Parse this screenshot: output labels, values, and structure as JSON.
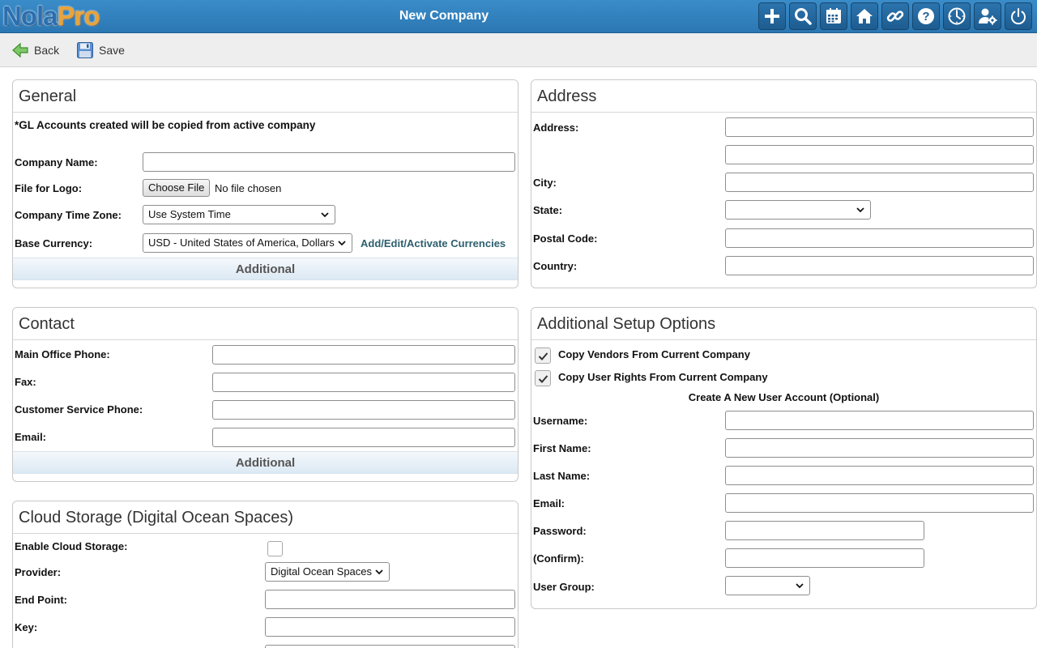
{
  "app": {
    "logo_part1": "Nola",
    "logo_part2": "Pro",
    "page_title": "New Company"
  },
  "header_icons": [
    "add-icon",
    "search-icon",
    "calendar-icon",
    "home-icon",
    "link-icon",
    "help-icon",
    "clock-icon",
    "user-settings-icon",
    "power-icon"
  ],
  "toolbar": {
    "back_label": "Back",
    "save_label": "Save"
  },
  "general": {
    "title": "General",
    "note": "*GL Accounts created will be copied from active company",
    "company_name_label": "Company Name:",
    "company_name_value": "",
    "logo_label": "File for Logo:",
    "choose_file_label": "Choose File",
    "no_file_text": "No file chosen",
    "timezone_label": "Company Time Zone:",
    "timezone_value": "Use System Time",
    "currency_label": "Base Currency:",
    "currency_value": "USD - United States of America, Dollars",
    "currency_link": "Add/Edit/Activate Currencies",
    "additional_label": "Additional"
  },
  "address": {
    "title": "Address",
    "address_label": "Address:",
    "city_label": "City:",
    "state_label": "State:",
    "postal_label": "Postal Code:",
    "country_label": "Country:"
  },
  "contact": {
    "title": "Contact",
    "phone_label": "Main Office Phone:",
    "fax_label": "Fax:",
    "cs_phone_label": "Customer Service Phone:",
    "email_label": "Email:",
    "additional_label": "Additional"
  },
  "setup": {
    "title": "Additional Setup Options",
    "copy_vendors_label": "Copy Vendors From Current Company",
    "copy_vendors_checked": true,
    "copy_rights_label": "Copy User Rights From Current Company",
    "copy_rights_checked": true,
    "new_user_heading": "Create A New User Account (Optional)",
    "username_label": "Username:",
    "first_name_label": "First Name:",
    "last_name_label": "Last Name:",
    "email_label": "Email:",
    "password_label": "Password:",
    "confirm_label": "(Confirm):",
    "user_group_label": "User Group:"
  },
  "cloud": {
    "title": "Cloud Storage (Digital Ocean Spaces)",
    "enable_label": "Enable Cloud Storage:",
    "enable_checked": false,
    "provider_label": "Provider:",
    "provider_value": "Digital Ocean Spaces",
    "endpoint_label": "End Point:",
    "key_label": "Key:"
  }
}
